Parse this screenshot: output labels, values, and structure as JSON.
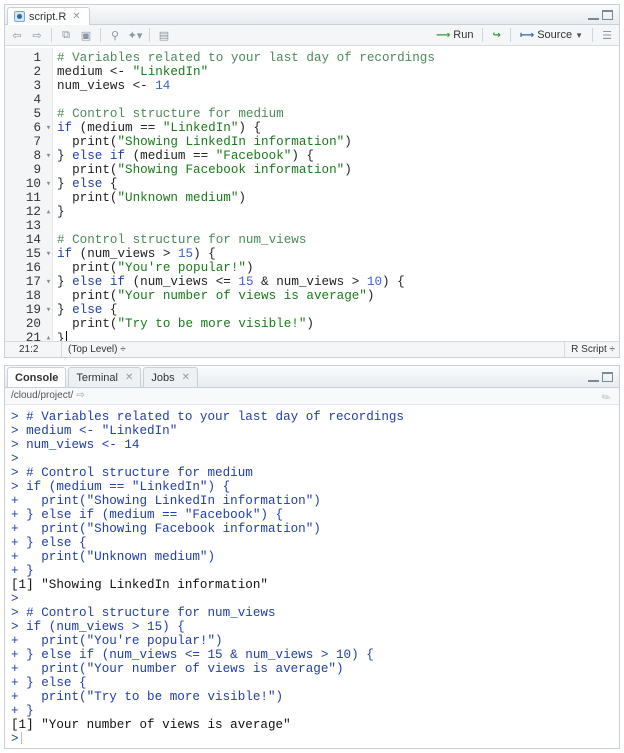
{
  "editor": {
    "tab_label": "script.R",
    "toolbar": {
      "run_label": "Run",
      "source_label": "Source"
    },
    "lines": [
      {
        "n": "1",
        "fold": "",
        "html": "<span class='tok-comment'># Variables related to your last day of recordings</span>"
      },
      {
        "n": "2",
        "fold": "",
        "html": "medium &lt;- <span class='tok-string'>\"LinkedIn\"</span>"
      },
      {
        "n": "3",
        "fold": "",
        "html": "num_views &lt;- <span class='tok-num'>14</span>"
      },
      {
        "n": "4",
        "fold": "",
        "html": ""
      },
      {
        "n": "5",
        "fold": "",
        "html": "<span class='tok-comment'># Control structure for medium</span>"
      },
      {
        "n": "6",
        "fold": "▾",
        "html": "<span class='tok-kw'>if</span> (medium == <span class='tok-string'>\"LinkedIn\"</span>) {"
      },
      {
        "n": "7",
        "fold": "",
        "html": "  print(<span class='tok-string'>\"Showing LinkedIn information\"</span>)"
      },
      {
        "n": "8",
        "fold": "▾",
        "html": "} <span class='tok-kw'>else if</span> (medium == <span class='tok-string'>\"Facebook\"</span>) {"
      },
      {
        "n": "9",
        "fold": "",
        "html": "  print(<span class='tok-string'>\"Showing Facebook information\"</span>)"
      },
      {
        "n": "10",
        "fold": "▾",
        "html": "} <span class='tok-kw'>else</span> {"
      },
      {
        "n": "11",
        "fold": "",
        "html": "  print(<span class='tok-string'>\"Unknown medium\"</span>)"
      },
      {
        "n": "12",
        "fold": "▴",
        "html": "}"
      },
      {
        "n": "13",
        "fold": "",
        "html": ""
      },
      {
        "n": "14",
        "fold": "",
        "html": "<span class='tok-comment'># Control structure for num_views</span>"
      },
      {
        "n": "15",
        "fold": "▾",
        "html": "<span class='tok-kw'>if</span> (num_views &gt; <span class='tok-num'>15</span>) {"
      },
      {
        "n": "16",
        "fold": "",
        "html": "  print(<span class='tok-string'>\"You're popular!\"</span>)"
      },
      {
        "n": "17",
        "fold": "▾",
        "html": "} <span class='tok-kw'>else if</span> (num_views &lt;= <span class='tok-num'>15</span> &amp; num_views &gt; <span class='tok-num'>10</span>) {"
      },
      {
        "n": "18",
        "fold": "",
        "html": "  print(<span class='tok-string'>\"Your number of views is average\"</span>)"
      },
      {
        "n": "19",
        "fold": "▾",
        "html": "} <span class='tok-kw'>else</span> {"
      },
      {
        "n": "20",
        "fold": "",
        "html": "  print(<span class='tok-string'>\"Try to be more visible!\"</span>)"
      },
      {
        "n": "21",
        "fold": "▴",
        "html": "}<span class='cursor'></span>"
      }
    ],
    "status": {
      "position": "21:2",
      "scope": "(Top Level) ÷",
      "language": "R Script ÷"
    }
  },
  "console": {
    "tabs": [
      {
        "label": "Console",
        "closable": false,
        "active": true
      },
      {
        "label": "Terminal",
        "closable": true,
        "active": false
      },
      {
        "label": "Jobs",
        "closable": true,
        "active": false
      }
    ],
    "path": "/cloud/project/",
    "lines": [
      {
        "type": "in",
        "text": "> # Variables related to your last day of recordings"
      },
      {
        "type": "in",
        "text": "> medium <- \"LinkedIn\""
      },
      {
        "type": "in",
        "text": "> num_views <- 14"
      },
      {
        "type": "in",
        "text": ">"
      },
      {
        "type": "in",
        "text": "> # Control structure for medium"
      },
      {
        "type": "in",
        "text": "> if (medium == \"LinkedIn\") {"
      },
      {
        "type": "in",
        "text": "+   print(\"Showing LinkedIn information\")"
      },
      {
        "type": "in",
        "text": "+ } else if (medium == \"Facebook\") {"
      },
      {
        "type": "in",
        "text": "+   print(\"Showing Facebook information\")"
      },
      {
        "type": "in",
        "text": "+ } else {"
      },
      {
        "type": "in",
        "text": "+   print(\"Unknown medium\")"
      },
      {
        "type": "in",
        "text": "+ }"
      },
      {
        "type": "out",
        "text": "[1] \"Showing LinkedIn information\""
      },
      {
        "type": "in",
        "text": ">"
      },
      {
        "type": "in",
        "text": "> # Control structure for num_views"
      },
      {
        "type": "in",
        "text": "> if (num_views > 15) {"
      },
      {
        "type": "in",
        "text": "+   print(\"You're popular!\")"
      },
      {
        "type": "in",
        "text": "+ } else if (num_views <= 15 & num_views > 10) {"
      },
      {
        "type": "in",
        "text": "+   print(\"Your number of views is average\")"
      },
      {
        "type": "in",
        "text": "+ } else {"
      },
      {
        "type": "in",
        "text": "+   print(\"Try to be more visible!\")"
      },
      {
        "type": "in",
        "text": "+ }"
      },
      {
        "type": "out",
        "text": "[1] \"Your number of views is average\""
      },
      {
        "type": "in",
        "text": ">"
      }
    ]
  }
}
